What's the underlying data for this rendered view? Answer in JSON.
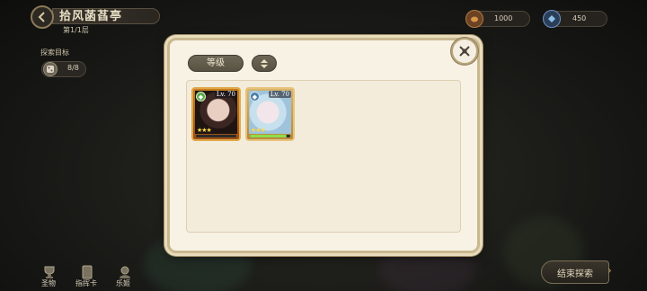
{
  "header": {
    "title": "拾风菡萏亭",
    "floor": "第1/1层"
  },
  "goal": {
    "label": "探索目标",
    "value": "8/8"
  },
  "currencies": [
    {
      "icon": "bread-icon",
      "value": "1000"
    },
    {
      "icon": "crystal-icon",
      "value": "450"
    }
  ],
  "bottom_nav": [
    {
      "icon": "trophy-icon",
      "label": "圣物"
    },
    {
      "icon": "card-icon",
      "label": "指挥卡"
    },
    {
      "icon": "girl-icon",
      "label": "乐姬"
    }
  ],
  "end_button": {
    "label": "结束探索"
  },
  "modal": {
    "sort_label": "等级",
    "characters": [
      {
        "level": "Lv. 70",
        "stars": 3,
        "element_color": "#5aa64a",
        "hp_fraction": 0.0
      },
      {
        "level": "Lv. 70",
        "stars": 3,
        "element_color": "#4a7ea6",
        "hp_fraction": 0.9
      }
    ]
  }
}
